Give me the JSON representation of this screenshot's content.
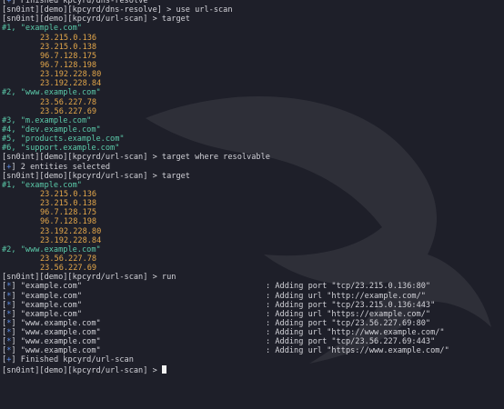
{
  "terminal": {
    "lines": [
      {
        "kind": "status",
        "marker": "+",
        "text": "Finished kpcyrd/dns-resolve"
      },
      {
        "kind": "prompt",
        "prompt": "[sn0int][demo][kpcyrd/dns-resolve] > ",
        "cmd": "use url-scan"
      },
      {
        "kind": "prompt",
        "prompt": "[sn0int][demo][kpcyrd/url-scan] > ",
        "cmd": "target"
      },
      {
        "kind": "entity",
        "idx": "#1,",
        "value": "\"example.com\""
      },
      {
        "kind": "ip",
        "value": "23.215.0.136"
      },
      {
        "kind": "ip",
        "value": "23.215.0.138"
      },
      {
        "kind": "ip",
        "value": "96.7.128.175"
      },
      {
        "kind": "ip",
        "value": "96.7.128.198"
      },
      {
        "kind": "ip",
        "value": "23.192.228.80"
      },
      {
        "kind": "ip",
        "value": "23.192.228.84"
      },
      {
        "kind": "entity",
        "idx": "#2,",
        "value": "\"www.example.com\""
      },
      {
        "kind": "ip",
        "value": "23.56.227.78"
      },
      {
        "kind": "ip",
        "value": "23.56.227.69"
      },
      {
        "kind": "entity",
        "idx": "#3,",
        "value": "\"m.example.com\""
      },
      {
        "kind": "entity",
        "idx": "#4,",
        "value": "\"dev.example.com\""
      },
      {
        "kind": "entity",
        "idx": "#5,",
        "value": "\"products.example.com\""
      },
      {
        "kind": "entity",
        "idx": "#6,",
        "value": "\"support.example.com\""
      },
      {
        "kind": "prompt",
        "prompt": "[sn0int][demo][kpcyrd/url-scan] > ",
        "cmd": "target where resolvable"
      },
      {
        "kind": "status",
        "marker": "+",
        "text": "2 entities selected"
      },
      {
        "kind": "prompt",
        "prompt": "[sn0int][demo][kpcyrd/url-scan] > ",
        "cmd": "target"
      },
      {
        "kind": "entity",
        "idx": "#1,",
        "value": "\"example.com\""
      },
      {
        "kind": "ip",
        "value": "23.215.0.136"
      },
      {
        "kind": "ip",
        "value": "23.215.0.138"
      },
      {
        "kind": "ip",
        "value": "96.7.128.175"
      },
      {
        "kind": "ip",
        "value": "96.7.128.198"
      },
      {
        "kind": "ip",
        "value": "23.192.228.80"
      },
      {
        "kind": "ip",
        "value": "23.192.228.84"
      },
      {
        "kind": "entity",
        "idx": "#2,",
        "value": "\"www.example.com\""
      },
      {
        "kind": "ip",
        "value": "23.56.227.78"
      },
      {
        "kind": "ip",
        "value": "23.56.227.69"
      },
      {
        "kind": "prompt",
        "prompt": "[sn0int][demo][kpcyrd/url-scan] > ",
        "cmd": "run"
      },
      {
        "kind": "log",
        "marker": "*",
        "target": "\"example.com\"",
        "msg": ": Adding port \"tcp/23.215.0.136:80\""
      },
      {
        "kind": "log",
        "marker": "*",
        "target": "\"example.com\"",
        "msg": ": Adding url \"http://example.com/\""
      },
      {
        "kind": "log",
        "marker": "*",
        "target": "\"example.com\"",
        "msg": ": Adding port \"tcp/23.215.0.136:443\""
      },
      {
        "kind": "log",
        "marker": "*",
        "target": "\"example.com\"",
        "msg": ": Adding url \"https://example.com/\""
      },
      {
        "kind": "log",
        "marker": "*",
        "target": "\"www.example.com\"",
        "msg": ": Adding port \"tcp/23.56.227.69:80\""
      },
      {
        "kind": "log",
        "marker": "*",
        "target": "\"www.example.com\"",
        "msg": ": Adding url \"http://www.example.com/\""
      },
      {
        "kind": "log",
        "marker": "*",
        "target": "\"www.example.com\"",
        "msg": ": Adding port \"tcp/23.56.227.69:443\""
      },
      {
        "kind": "log",
        "marker": "*",
        "target": "\"www.example.com\"",
        "msg": ": Adding url \"https://www.example.com/\""
      },
      {
        "kind": "status",
        "marker": "+",
        "text": "Finished kpcyrd/url-scan"
      },
      {
        "kind": "input",
        "prompt": "[sn0int][demo][kpcyrd/url-scan] > ",
        "cmd": ""
      }
    ]
  },
  "colors": {
    "background": "#1e1f29",
    "text": "#d2d2d8",
    "marker": "#5f8de5",
    "entity": "#5bc9a9",
    "ip": "#e2a64a"
  },
  "watermark": {
    "icon": "kali-dragon-icon"
  }
}
